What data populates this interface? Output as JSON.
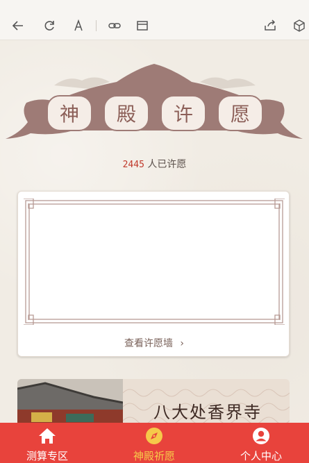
{
  "toolbar": {
    "icons": [
      "back-arrow-icon",
      "refresh-icon",
      "font-size-icon",
      "link-icon",
      "window-icon",
      "share-icon",
      "cube-icon"
    ]
  },
  "banner": {
    "chars": [
      "神",
      "殿",
      "许",
      "愿"
    ],
    "colors": {
      "plaque": "#9e7b76",
      "medallion": "#f5ede7",
      "text": "#8c5f58"
    }
  },
  "wish_count": {
    "number": "2445",
    "suffix": " 人已许愿"
  },
  "wish_card": {
    "link_label": "查看许愿墙",
    "chevron": "›"
  },
  "temple_card": {
    "title": "八大处香界寺"
  },
  "bottom_nav": {
    "items": [
      {
        "label": "测算专区",
        "icon": "home-icon",
        "active": false
      },
      {
        "label": "神殿祈愿",
        "icon": "compass-icon",
        "active": true
      },
      {
        "label": "个人中心",
        "icon": "user-icon",
        "active": false
      }
    ],
    "colors": {
      "bg": "#e8433c",
      "active": "#f6c94a"
    }
  }
}
